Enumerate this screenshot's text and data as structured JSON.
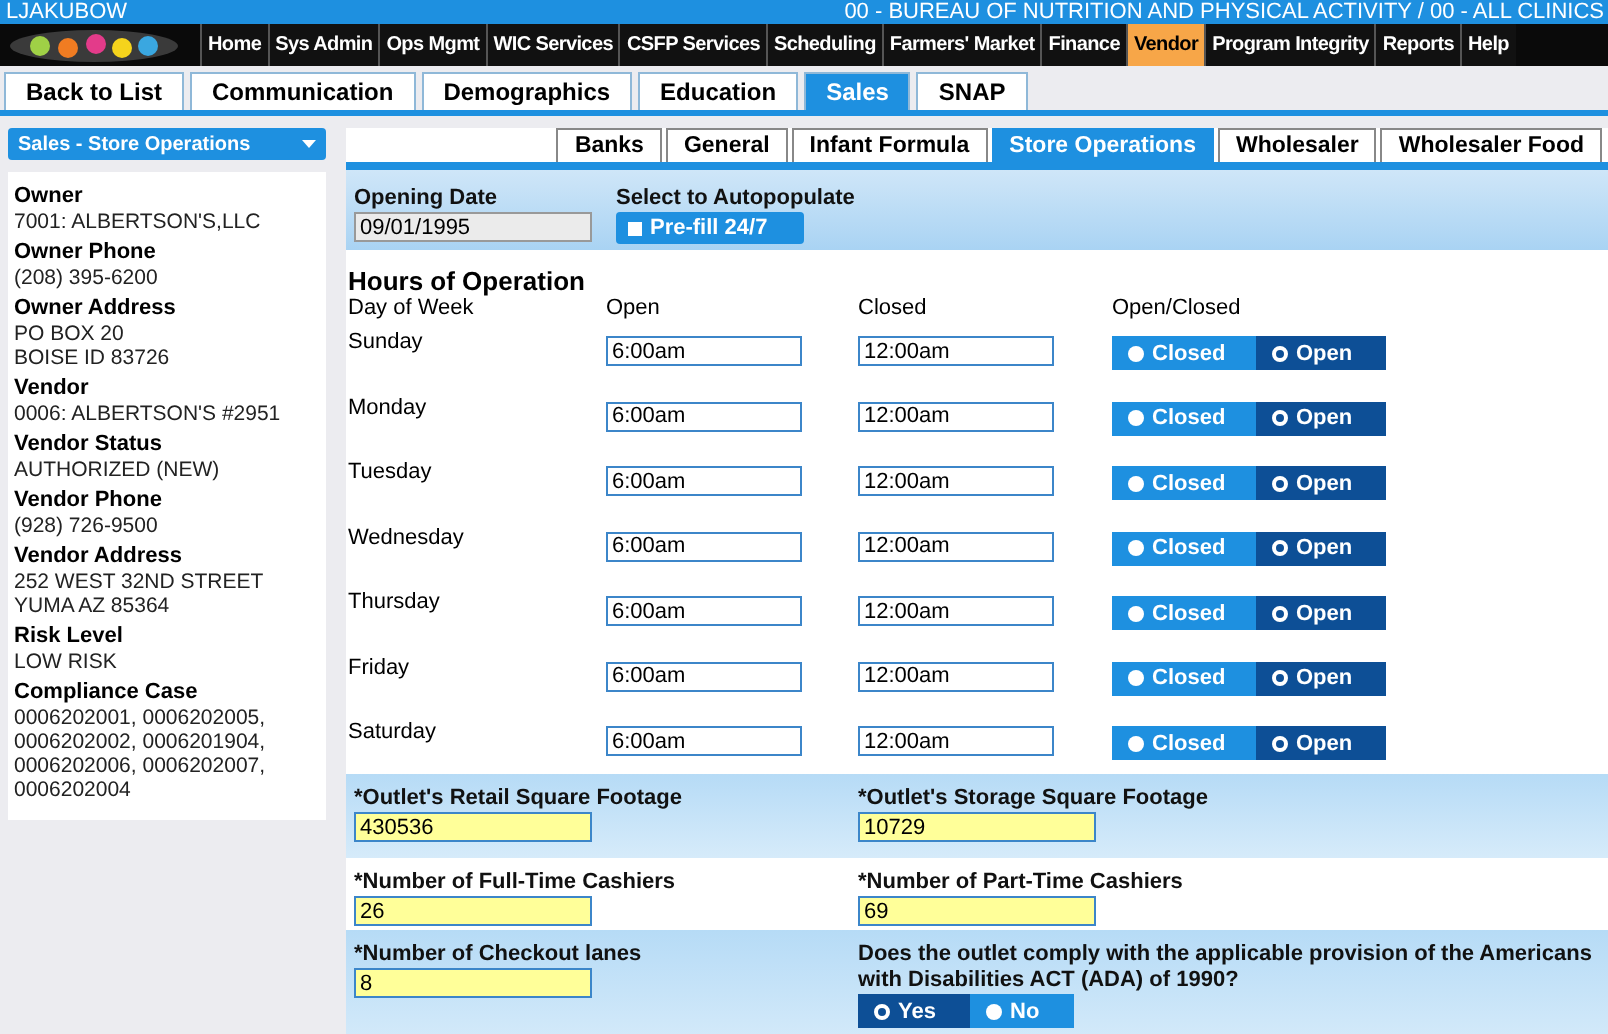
{
  "header": {
    "user": "LJAKUBOW",
    "agency": "00 - BUREAU OF NUTRITION AND PHYSICAL ACTIVITY / 00 - ALL CLINICS"
  },
  "nav": [
    {
      "label": "Home",
      "selected": false
    },
    {
      "label": "Sys Admin",
      "selected": false
    },
    {
      "label": "Ops Mgmt",
      "selected": false
    },
    {
      "label": "WIC Services",
      "selected": false
    },
    {
      "label": "CSFP Services",
      "selected": false
    },
    {
      "label": "Scheduling",
      "selected": false
    },
    {
      "label": "Farmers' Market",
      "selected": false
    },
    {
      "label": "Finance",
      "selected": false
    },
    {
      "label": "Vendor",
      "selected": true
    },
    {
      "label": "Program Integrity",
      "selected": false
    },
    {
      "label": "Reports",
      "selected": false
    },
    {
      "label": "Help",
      "selected": false
    }
  ],
  "tabs": [
    {
      "label": "Back to List",
      "selected": false
    },
    {
      "label": "Communication",
      "selected": false
    },
    {
      "label": "Demographics",
      "selected": false
    },
    {
      "label": "Education",
      "selected": false
    },
    {
      "label": "Sales",
      "selected": true
    },
    {
      "label": "SNAP",
      "selected": false
    }
  ],
  "sidebar": {
    "dropdown": "Sales - Store Operations",
    "fields": [
      {
        "label": "Owner",
        "lines": [
          "7001: ALBERTSON'S,LLC"
        ]
      },
      {
        "label": "Owner Phone",
        "lines": [
          "(208) 395-6200"
        ]
      },
      {
        "label": "Owner Address",
        "lines": [
          "PO BOX 20",
          "BOISE ID 83726"
        ]
      },
      {
        "label": "Vendor",
        "lines": [
          "0006: ALBERTSON'S #2951"
        ]
      },
      {
        "label": "Vendor Status",
        "lines": [
          "AUTHORIZED (NEW)"
        ]
      },
      {
        "label": "Vendor Phone",
        "lines": [
          "(928) 726-9500"
        ]
      },
      {
        "label": "Vendor Address",
        "lines": [
          "252 WEST 32ND STREET",
          "YUMA AZ 85364"
        ]
      },
      {
        "label": "Risk Level",
        "lines": [
          "LOW RISK"
        ]
      },
      {
        "label": "Compliance Case",
        "lines": [
          "0006202001, 0006202005,",
          "0006202002, 0006201904,",
          "0006202006, 0006202007,",
          "0006202004"
        ]
      }
    ]
  },
  "subtabs": [
    {
      "label": "Banks",
      "selected": false
    },
    {
      "label": "General",
      "selected": false
    },
    {
      "label": "Infant Formula",
      "selected": false
    },
    {
      "label": "Store Operations",
      "selected": true
    },
    {
      "label": "Wholesaler",
      "selected": false
    },
    {
      "label": "Wholesaler Food",
      "selected": false
    }
  ],
  "opening": {
    "label": "Opening Date",
    "value": "09/01/1995",
    "autopopulate_label": "Select to Autopopulate",
    "prefill_button": "Pre-fill 24/7"
  },
  "hours": {
    "title": "Hours of Operation",
    "columns": [
      "Day of Week",
      "Open",
      "Closed",
      "Open/Closed"
    ],
    "days": [
      {
        "day": "Sunday",
        "open": "6:00am",
        "close": "12:00am",
        "status": [
          {
            "label": "Closed",
            "selected": false
          },
          {
            "label": "Open",
            "selected": true
          }
        ]
      },
      {
        "day": "Monday",
        "open": "6:00am",
        "close": "12:00am",
        "status": [
          {
            "label": "Closed",
            "selected": false
          },
          {
            "label": "Open",
            "selected": true
          }
        ]
      },
      {
        "day": "Tuesday",
        "open": "6:00am",
        "close": "12:00am",
        "status": [
          {
            "label": "Closed",
            "selected": false
          },
          {
            "label": "Open",
            "selected": true
          }
        ]
      },
      {
        "day": "Wednesday",
        "open": "6:00am",
        "close": "12:00am",
        "status": [
          {
            "label": "Closed",
            "selected": false
          },
          {
            "label": "Open",
            "selected": true
          }
        ]
      },
      {
        "day": "Thursday",
        "open": "6:00am",
        "close": "12:00am",
        "status": [
          {
            "label": "Closed",
            "selected": false
          },
          {
            "label": "Open",
            "selected": true
          }
        ]
      },
      {
        "day": "Friday",
        "open": "6:00am",
        "close": "12:00am",
        "status": [
          {
            "label": "Closed",
            "selected": false
          },
          {
            "label": "Open",
            "selected": true
          }
        ]
      },
      {
        "day": "Saturday",
        "open": "6:00am",
        "close": "12:00am",
        "status": [
          {
            "label": "Closed",
            "selected": false
          },
          {
            "label": "Open",
            "selected": true
          }
        ]
      }
    ]
  },
  "details": {
    "retail_sqft": {
      "label": "*Outlet's Retail Square Footage",
      "value": "430536"
    },
    "storage_sqft": {
      "label": "*Outlet's Storage Square Footage",
      "value": "10729"
    },
    "fulltime_cashiers": {
      "label": "*Number of Full-Time Cashiers",
      "value": "26"
    },
    "parttime_cashiers": {
      "label": "*Number of Part-Time Cashiers",
      "value": "69"
    },
    "checkout_lanes": {
      "label": "*Number of Checkout lanes",
      "value": "8"
    },
    "ada": {
      "question": "Does the outlet comply with the applicable provision of the Americans with Disabilities ACT (ADA) of 1990?",
      "options": [
        {
          "label": "Yes",
          "selected": true
        },
        {
          "label": "No",
          "selected": false
        }
      ]
    }
  }
}
